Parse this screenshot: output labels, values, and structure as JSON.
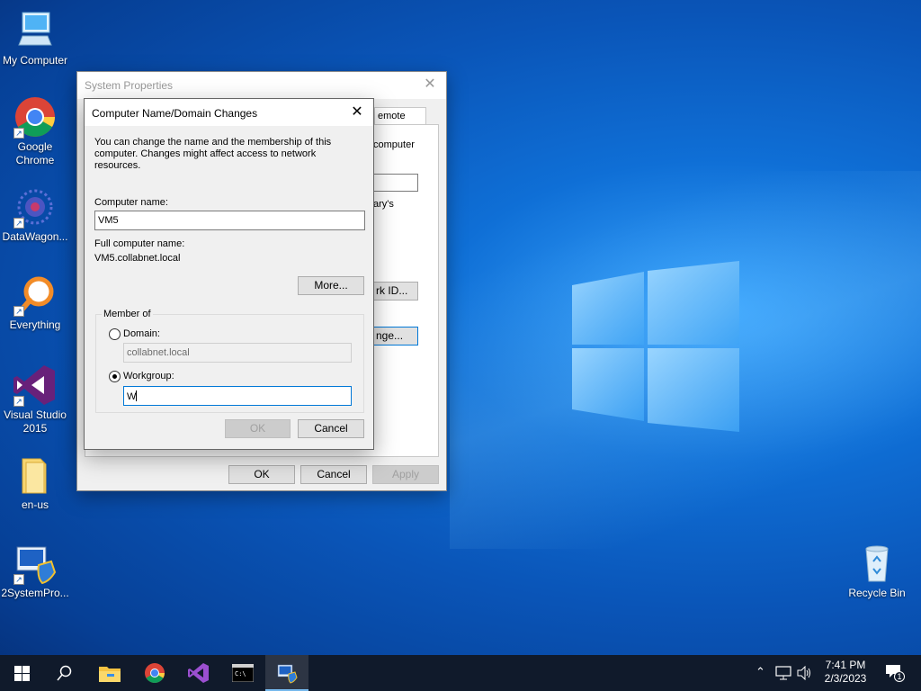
{
  "desktop": {
    "icons": [
      {
        "label": "My Computer",
        "icon": "computer-icon"
      },
      {
        "label": "Google Chrome",
        "icon": "chrome-icon"
      },
      {
        "label": "DataWagon...",
        "icon": "datawagon-icon"
      },
      {
        "label": "Everything",
        "icon": "everything-search-icon"
      },
      {
        "label": "Visual Studio 2015",
        "icon": "visual-studio-icon"
      },
      {
        "label": "en-us",
        "icon": "folder-icon"
      },
      {
        "label": "2SystemPro...",
        "icon": "system-properties-icon"
      },
      {
        "label": "Recycle Bin",
        "icon": "recycle-bin-icon"
      }
    ]
  },
  "system_properties": {
    "title": "System Properties",
    "tab_fragment": "emote",
    "text_fragments": [
      "computer",
      "ary's"
    ],
    "button_fragments": {
      "network_id": "rk ID...",
      "change": "nge..."
    },
    "buttons": {
      "ok": "OK",
      "cancel": "Cancel",
      "apply": "Apply"
    }
  },
  "dialog": {
    "title": "Computer Name/Domain Changes",
    "description": "You can change the name and the membership of this computer. Changes might affect access to network resources.",
    "computer_name_label": "Computer name:",
    "computer_name_value": "VM5",
    "full_name_label": "Full computer name:",
    "full_name_value": "VM5.collabnet.local",
    "more_button": "More...",
    "member_of_label": "Member of",
    "domain_label": "Domain:",
    "domain_value": "collabnet.local",
    "workgroup_label": "Workgroup:",
    "workgroup_value": "W",
    "ok_button": "OK",
    "cancel_button": "Cancel"
  },
  "taskbar": {
    "items": [
      "start-icon",
      "search-icon",
      "file-explorer-icon",
      "chrome-icon",
      "visual-studio-icon",
      "command-prompt-icon",
      "system-properties-icon"
    ],
    "time": "7:41 PM",
    "date": "2/3/2023",
    "notification_count": "1"
  },
  "colors": {
    "accent": "#0078d7",
    "taskbar": "#101a2b"
  }
}
